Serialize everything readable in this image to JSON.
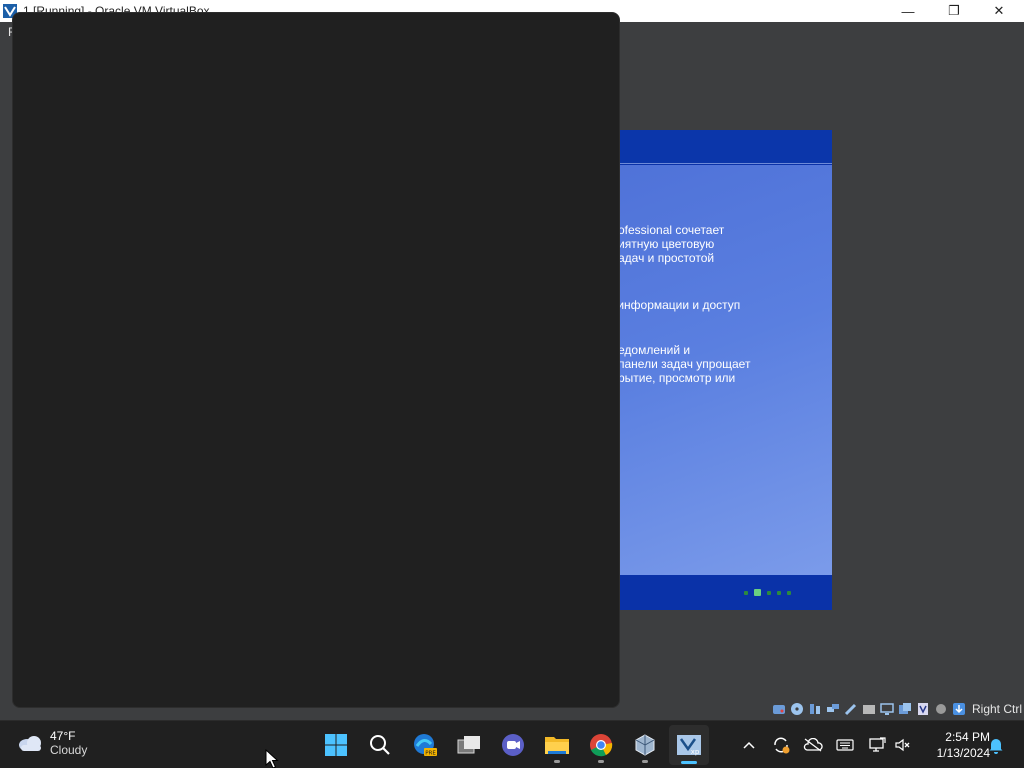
{
  "window": {
    "title": "1 [Running] - Oracle VM VirtualBox",
    "menu_first": "F",
    "minimize_glyph": "—",
    "maximize_glyph": "❐",
    "close_glyph": "✕"
  },
  "guest": {
    "lines_1": "ofessional сочетает\nиятную цветовую\nадач и простотой",
    "lines_2": " информации и доступ",
    "lines_3": "едомлений и\nпанели задач упрощает\nрытие, просмотр или",
    "page_dots": 5,
    "active_dot": 2
  },
  "statusbar": {
    "icons": [
      "hard-disk-icon",
      "optical-drive-icon",
      "audio-icon",
      "network-icon",
      "usb-icon",
      "shared-folders-icon",
      "display-icon",
      "recording-icon",
      "virtualization-icon",
      "mouse-integration-icon",
      "keyboard-capture-icon"
    ],
    "host_key": "Right Ctrl"
  },
  "taskbar": {
    "weather": {
      "temp": "47°F",
      "condition": "Cloudy"
    },
    "apps": [
      "start",
      "search",
      "edge-beta",
      "task-view",
      "teams-chat",
      "file-explorer",
      "chrome",
      "virtualbox",
      "virtualbox-vm-xp"
    ],
    "time": "2:54 PM",
    "date": "1/13/2024"
  },
  "colors": {
    "accent": "#4cc2ff",
    "xp_blue": "#0a32a8"
  }
}
